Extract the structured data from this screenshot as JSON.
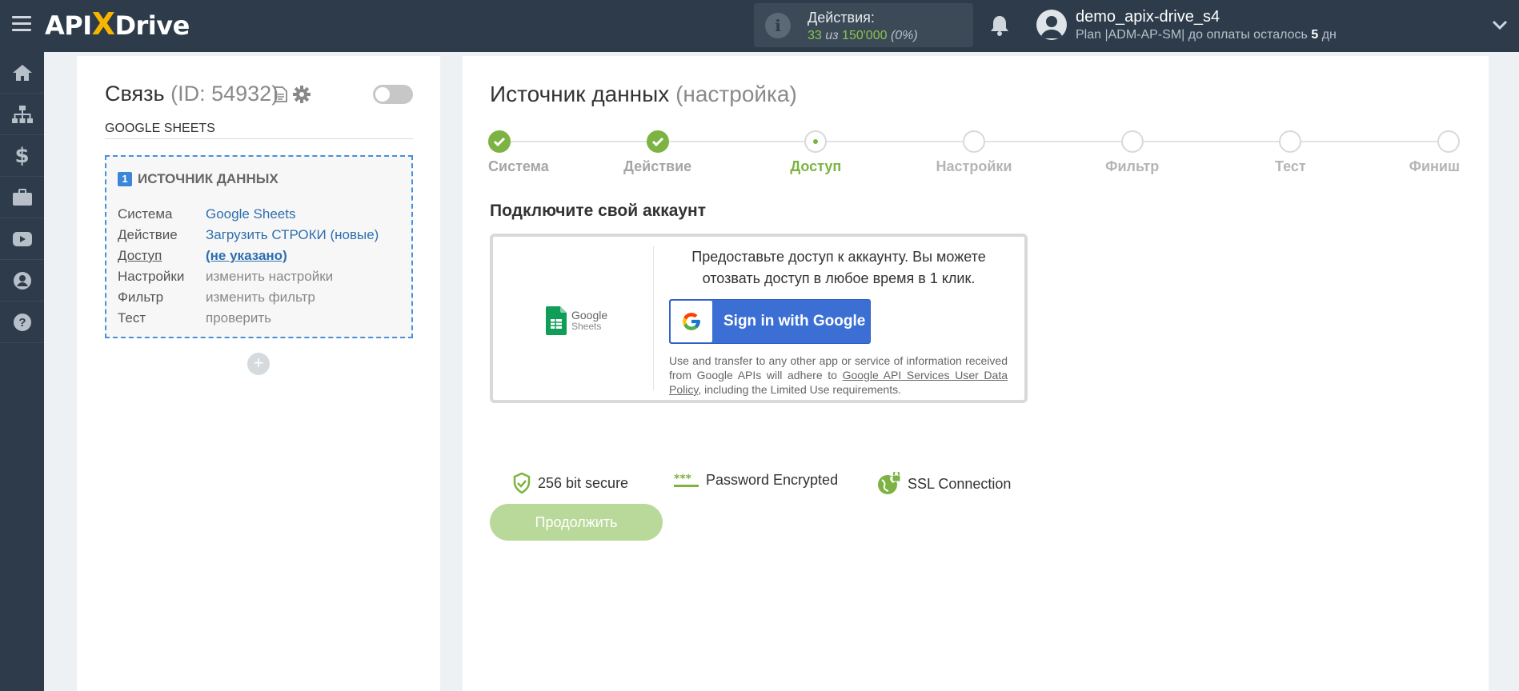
{
  "header": {
    "logo_prefix": "API",
    "logo_x": "X",
    "logo_suffix": "Drive",
    "actions_label": "Действия:",
    "actions_used": "33",
    "actions_of": "из",
    "actions_total": "150'000",
    "actions_percent": "(0%)",
    "username": "demo_apix-drive_s4",
    "plan_text": "Plan |ADM-AP-SM| до оплаты осталось",
    "plan_days": "5",
    "plan_days_unit": "дн"
  },
  "sidebar": {
    "items": [
      "home-icon",
      "sitemap-icon",
      "dollar-icon",
      "briefcase-icon",
      "youtube-icon",
      "user-icon",
      "help-icon"
    ]
  },
  "connection": {
    "title": "Связь",
    "id_label": "(ID: 54932)",
    "subtitle": "GOOGLE SHEETS",
    "source_number": "1",
    "source_heading": "ИСТОЧНИК ДАННЫХ",
    "rows": [
      {
        "key": "Система",
        "value": "Google Sheets"
      },
      {
        "key": "Действие",
        "value": "Загрузить СТРОКИ (новые)"
      },
      {
        "key": "Доступ",
        "value": "(не указано)"
      },
      {
        "key": "Настройки",
        "value": "изменить настройки"
      },
      {
        "key": "Фильтр",
        "value": "изменить фильтр"
      },
      {
        "key": "Тест",
        "value": "проверить"
      }
    ],
    "add_label": "+"
  },
  "main": {
    "title": "Источник данных",
    "title_note": "(настройка)",
    "steps": [
      {
        "label": "Система",
        "state": "done"
      },
      {
        "label": "Действие",
        "state": "done"
      },
      {
        "label": "Доступ",
        "state": "active"
      },
      {
        "label": "Настройки",
        "state": "todo"
      },
      {
        "label": "Фильтр",
        "state": "todo"
      },
      {
        "label": "Тест",
        "state": "todo"
      },
      {
        "label": "Финиш",
        "state": "todo"
      }
    ],
    "connect_heading": "Подключите свой аккаунт",
    "gs_logo_line1": "Google",
    "gs_logo_line2": "Sheets",
    "card_text": "Предоставьте доступ к аккаунту. Вы можете отозвать доступ в любое время в 1 клик.",
    "google_button": "Sign in with Google",
    "policy_before": "Use and transfer to any other app or service of information received from Google APIs will adhere to",
    "policy_link": "Google API Services User Data Policy",
    "policy_after": ", including the Limited Use requirements.",
    "security": [
      {
        "icon": "shield-check-icon",
        "label": "256 bit secure"
      },
      {
        "icon": "password-icon",
        "label": "Password Encrypted"
      },
      {
        "icon": "globe-lock-icon",
        "label": "SSL Connection"
      }
    ],
    "continue_button": "Продолжить"
  },
  "colors": {
    "topbar": "#2d3b4a",
    "accent_green": "#7cb342",
    "google_blue": "#3b6fd4",
    "link_blue": "#2f6fb0"
  }
}
